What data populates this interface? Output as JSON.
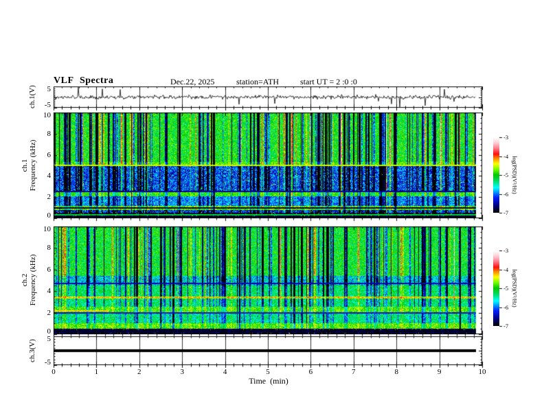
{
  "header": {
    "title": "VLF Spectra",
    "date": "Dec.22, 2025",
    "station": "station=ATH",
    "start_ut": "start UT =  2 :0 :0"
  },
  "x_axis": {
    "label": "Time (min)",
    "min": 0,
    "max": 10,
    "major_ticks": [
      "0",
      "1",
      "2",
      "3",
      "4",
      "5",
      "6",
      "7",
      "8",
      "9",
      "10"
    ],
    "minor_per_major": 5
  },
  "colorbar": {
    "label": "log(PSD)(V²/Hz)",
    "ticks": [
      "-3",
      "-4",
      "-5",
      "-6",
      "-7"
    ],
    "max": -3,
    "min": -7,
    "colormap_stops": [
      [
        0.0,
        "#000000"
      ],
      [
        0.09,
        "#000080"
      ],
      [
        0.2,
        "#0020ff"
      ],
      [
        0.33,
        "#00ffff"
      ],
      [
        0.42,
        "#00dd66"
      ],
      [
        0.5,
        "#00c800"
      ],
      [
        0.58,
        "#7fff00"
      ],
      [
        0.65,
        "#ffff00"
      ],
      [
        0.72,
        "#ff8c00"
      ],
      [
        0.78,
        "#ff1010"
      ],
      [
        0.86,
        "#ff8090"
      ],
      [
        0.93,
        "#ffd0d8"
      ],
      [
        1.0,
        "#ffffff"
      ]
    ]
  },
  "chart_data": {
    "type": "heatmap",
    "title": "VLF Spectra",
    "annotations": [
      "Dec.22, 2025",
      "station=ATH",
      "start UT =  2 :0 :0"
    ],
    "x": {
      "label": "Time (min)",
      "range": [
        0,
        10
      ],
      "units": "min",
      "data_end_min": 9.85
    },
    "legend_position": "right-colorbars",
    "grid": "ticks-all-edges",
    "panels": [
      {
        "id": "ch1_voltage",
        "type": "line",
        "ylabel": "ch.1(V)",
        "yticks": [
          "5",
          "-5"
        ],
        "yrange": [
          -5,
          5
        ],
        "signal": {
          "mean": 0,
          "noise_std": 0.42,
          "spike_probability": 0.022,
          "spike_amplitude_range": [
            1.5,
            4.4
          ],
          "duration_min": 9.85,
          "seed": 101
        }
      },
      {
        "id": "ch1_spectrogram",
        "type": "spectrogram",
        "ylabel": [
          "ch.1",
          "Frequency (kHz)"
        ],
        "yticks": [
          "10",
          "8",
          "6",
          "4",
          "2",
          "0"
        ],
        "yrange": [
          0,
          10
        ],
        "zlabel": "log(PSD)(V²/Hz)",
        "zrange": [
          -7,
          -3
        ],
        "seed": 202,
        "bands": [
          {
            "f": [
              5.35,
              10.0
            ],
            "psd": -5.05,
            "noise": 0.45,
            "streak_gain": 1.0,
            "speckle": 0
          },
          {
            "f": [
              4.95,
              5.35
            ],
            "psd": -4.75,
            "noise": 0.3,
            "streak_gain": 0.8,
            "speckle": 0
          },
          {
            "f": [
              2.45,
              4.95
            ],
            "psd": -6.15,
            "noise": 0.55,
            "streak_gain": 0.9,
            "speckle": 0.02
          },
          {
            "f": [
              2.05,
              2.45
            ],
            "psd": -4.9,
            "noise": 0.35,
            "streak_gain": 0.5,
            "speckle": 0
          },
          {
            "f": [
              1.15,
              2.05
            ],
            "psd": -5.95,
            "noise": 0.45,
            "streak_gain": 0.5,
            "speckle": 0.02
          },
          {
            "f": [
              0.75,
              1.15
            ],
            "psd": -4.7,
            "noise": 0.5,
            "streak_gain": 0.4,
            "speckle": 0
          },
          {
            "f": [
              0.5,
              0.75
            ],
            "psd": -6.3,
            "noise": 0.6,
            "streak_gain": 0.6,
            "speckle": 0.03
          },
          {
            "f": [
              0.0,
              0.5
            ],
            "psd": -6.9,
            "noise": 0.25,
            "streak_gain": 0.3,
            "speckle": 0.06
          }
        ],
        "lines": [
          {
            "f": 5.0,
            "psd": -4.5
          },
          {
            "f": 2.5,
            "psd": -6.6
          },
          {
            "f": 0.95,
            "psd": -6.9
          },
          {
            "f": 0.3,
            "psd": -5.2
          },
          {
            "f": 0.12,
            "psd": -6.9
          }
        ],
        "streaks": {
          "dark_count": 150,
          "dark_amp": [
            1.0,
            2.8
          ],
          "bright_count": 55,
          "bright_amp": [
            0.6,
            1.6
          ]
        }
      },
      {
        "id": "ch2_spectrogram",
        "type": "spectrogram",
        "ylabel": [
          "ch.2",
          "Frequency (kHz)"
        ],
        "yticks": [
          "10",
          "8",
          "6",
          "4",
          "2",
          "0"
        ],
        "yrange": [
          0,
          10
        ],
        "zlabel": "log(PSD)(V²/Hz)",
        "zrange": [
          -7,
          -3
        ],
        "seed": 303,
        "bands": [
          {
            "f": [
              5.4,
              10.0
            ],
            "psd": -5.1,
            "noise": 0.45,
            "streak_gain": 1.0,
            "speckle": 0
          },
          {
            "f": [
              4.55,
              5.4
            ],
            "psd": -5.7,
            "noise": 0.55,
            "streak_gain": 0.9,
            "speckle": 0
          },
          {
            "f": [
              3.5,
              4.55
            ],
            "psd": -5.25,
            "noise": 0.45,
            "streak_gain": 0.7,
            "speckle": 0
          },
          {
            "f": [
              3.3,
              3.5
            ],
            "psd": -4.35,
            "noise": 0.3,
            "streak_gain": 0.3,
            "speckle": 0
          },
          {
            "f": [
              2.55,
              3.3
            ],
            "psd": -5.3,
            "noise": 0.45,
            "streak_gain": 0.6,
            "speckle": 0
          },
          {
            "f": [
              2.0,
              2.55
            ],
            "psd": -4.8,
            "noise": 0.35,
            "streak_gain": 0.4,
            "speckle": 0
          },
          {
            "f": [
              1.0,
              2.0
            ],
            "psd": -5.35,
            "noise": 0.45,
            "streak_gain": 0.4,
            "speckle": 0
          },
          {
            "f": [
              0.45,
              1.0
            ],
            "psd": -4.75,
            "noise": 0.35,
            "streak_gain": 0.3,
            "speckle": 0
          },
          {
            "f": [
              0.0,
              0.45
            ],
            "psd": -6.8,
            "noise": 0.4,
            "streak_gain": 0.3,
            "speckle": 0.05
          }
        ],
        "lines": [
          {
            "f": 4.7,
            "psd": -6.5
          },
          {
            "f": 3.4,
            "psd": -4.1,
            "dash": true
          },
          {
            "f": 2.15,
            "psd": -4.3,
            "xmax_frac": 0.13
          },
          {
            "f": 1.95,
            "psd": -6.4
          },
          {
            "f": 0.3,
            "psd": -6.9
          },
          {
            "f": 0.15,
            "psd": -6.9
          }
        ],
        "streaks": {
          "dark_count": 130,
          "dark_amp": [
            1.0,
            2.6
          ],
          "bright_count": 45,
          "bright_amp": [
            0.6,
            1.4
          ]
        }
      },
      {
        "id": "ch3_voltage",
        "type": "line",
        "ylabel": "ch.3(V)",
        "yticks": [
          "5",
          "-5"
        ],
        "yrange": [
          -5,
          5
        ],
        "signal": {
          "mean": 0,
          "flat_bar": true,
          "bar_value": 0,
          "bar_thickness_px": 4,
          "duration_min": 9.85,
          "seed": 404
        }
      }
    ]
  }
}
